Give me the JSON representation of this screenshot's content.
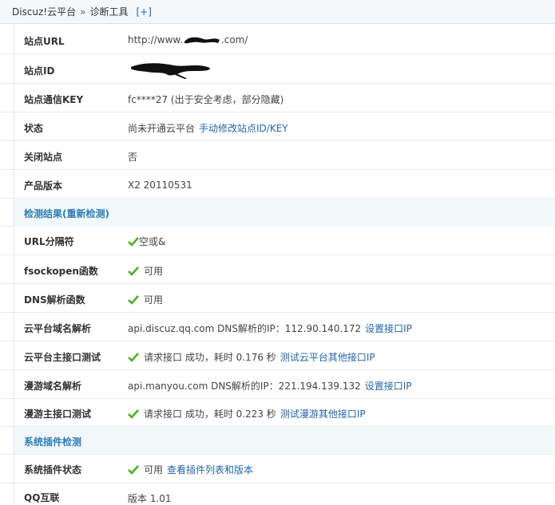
{
  "breadcrumb": {
    "root": "Discuz!云平台",
    "separator": "»",
    "current": "诊断工具",
    "add": "[+]"
  },
  "site_info": [
    {
      "label": "站点URL",
      "value": "http://www.",
      "value_tail": ".com/"
    },
    {
      "label": "站点ID",
      "value": ""
    },
    {
      "label": "站点通信KEY",
      "value": "fc****27 (出于安全考虑，部分隐藏)"
    },
    {
      "label": "状态",
      "value": "尚未开通云平台",
      "link": "手动修改站点ID/KEY"
    },
    {
      "label": "关闭站点",
      "value": "否"
    },
    {
      "label": "产品版本",
      "value": "X2 20110531"
    }
  ],
  "check_section": {
    "title": "检测结果(重新检测)"
  },
  "checks": [
    {
      "label": "URL分隔符",
      "value": "空或&",
      "check": true
    },
    {
      "label": "fsockopen函数",
      "value": "可用",
      "check": true
    },
    {
      "label": "DNS解析函数",
      "value": "可用",
      "check": true
    },
    {
      "label": "云平台域名解析",
      "value": "api.discuz.qq.com DNS解析的IP：112.90.140.172",
      "link": "设置接口IP"
    },
    {
      "label": "云平台主接口测试",
      "value": "请求接口 成功，耗时 0.176 秒",
      "check": true,
      "link": "测试云平台其他接口IP"
    },
    {
      "label": "漫游域名解析",
      "value": "api.manyou.com DNS解析的IP：221.194.139.132",
      "link": "设置接口IP"
    },
    {
      "label": "漫游主接口测试",
      "value": "请求接口 成功，耗时 0.223 秒",
      "check": true,
      "link": "测试漫游其他接口IP"
    }
  ],
  "plugin_section": {
    "title": "系统插件检测"
  },
  "plugins": [
    {
      "label": "系统插件状态",
      "value": "可用",
      "check": true,
      "link": "查看插件列表和版本"
    },
    {
      "label": "QQ互联",
      "value": "版本 1.01"
    }
  ],
  "colors": {
    "link": "#2366a8",
    "section_title": "#2a7fb3",
    "check": "#4fae2b"
  }
}
